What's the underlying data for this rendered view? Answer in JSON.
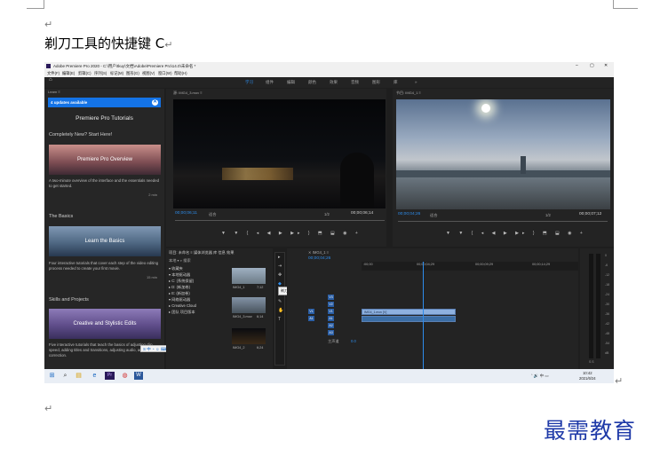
{
  "document": {
    "paragraph_mark": "↵",
    "heading": "剃刀工具的快捷键 C",
    "watermark": "最需教育"
  },
  "app": {
    "title": "Adobe Premiere Pro 2020 - C:\\用户\\tkuy\\文档\\Adobe\\Premiere Pro\\14.0\\未命名 *",
    "window_controls": [
      "–",
      "▢",
      "✕"
    ],
    "menu": [
      "文件(F)",
      "编辑(E)",
      "剪辑(C)",
      "序列(S)",
      "标记(M)",
      "图形(G)",
      "视图(V)",
      "窗口(W)",
      "帮助(H)"
    ],
    "workspaces": [
      "学习",
      "组件",
      "编辑",
      "颜色",
      "效果",
      "音频",
      "图形",
      "库"
    ],
    "active_workspace": "学习",
    "home_icon": "⌂",
    "more_icon": "»"
  },
  "learn": {
    "header": "Learn ≡",
    "updates": "4 updates available",
    "close_icon": "✕",
    "title": "Premiere Pro Tutorials",
    "sections": [
      {
        "heading": "Completely New? Start Here!",
        "card": "Premiere Pro Overview",
        "desc": "A two-minute overview of the interface and the essentials needed to get started.",
        "duration": "2 min"
      },
      {
        "heading": "The Basics",
        "card": "Learn the Basics",
        "desc": "Four interactive tutorials that cover each step of the video editing process needed to create your first movie.",
        "duration": "15 min"
      },
      {
        "heading": "Skills and Projects",
        "card": "Creative and Stylistic Edits",
        "desc": "Five interactive tutorials that teach the basics of adjusting clip speed, adding titles and transitions, adjusting audio, and color correction.",
        "duration": ""
      }
    ]
  },
  "source_monitor": {
    "tab": "源: IMG4_3.mov ≡",
    "timecode_left": "00;00;06;11",
    "fit": "适合",
    "ratio": "1/2",
    "timecode_right": "00;00;06;14",
    "controls": "▼ ▼ { ◂ ◀ ▶ ▶▸ } ⬒ ⬓ ◉ +"
  },
  "program_monitor": {
    "tab": "节目: IMG4_1 ≡",
    "timecode_left": "00;00;04;26",
    "fit": "适合",
    "ratio": "1/2",
    "timecode_right": "00;00;07;12",
    "controls": "▼ ▼ { ◂ ◀ ▶ ▶▸ } ⬒ ⬓ ◉ +"
  },
  "project": {
    "tabs": "项目: 未命名 ≡   媒体浏览器   库   信息   效果",
    "location": "本地 ▾   ⌕ 搜索",
    "tree": [
      "▾ 收藏夹",
      "▾ 本地驱动器",
      "  ▸ C: (系统保留)",
      "  ▸ D: (新加卷)",
      "  ▸ E: (新加卷)",
      "▾ 网络驱动器",
      "▸ Creative Cloud",
      "  ▸ 团队 项目版本"
    ],
    "clips": [
      {
        "name": "IMG4_1",
        "dur": "7;12"
      },
      {
        "name": "IMG4_3.mov",
        "dur": "6;14"
      },
      {
        "name": "IMG4_2",
        "dur": "6;24"
      }
    ]
  },
  "toolbar": {
    "tools": [
      "▸",
      "⇥",
      "✥",
      "◆",
      "⟷",
      "✎",
      "✋",
      "T"
    ],
    "tooltip": "剃刀工具 (C)"
  },
  "timeline": {
    "tab": "✕ IMG4_1 ≡",
    "timecode": "00;00;04;26",
    "ruler": [
      ":00;00",
      "00;00;04;29",
      "00;00;09;29",
      "00;00;14;29"
    ],
    "tracks": [
      "V3",
      "V2",
      "V1",
      "A1",
      "A2",
      "A3"
    ],
    "master": "主声道",
    "master_val": "0.0",
    "video_clip": "IMG4_1.mov [V]",
    "audio_clip": ""
  },
  "meters": {
    "ticks": [
      "0",
      "-6",
      "-12",
      "-18",
      "-24",
      "-30",
      "-36",
      "-42",
      "-48",
      "-54",
      "dB"
    ],
    "solo": "S S"
  },
  "taskbar": {
    "icons": [
      "⊞",
      "⌕",
      "▤",
      "e",
      "Pr",
      "◍",
      "W"
    ],
    "tray": "ˆ 🔊 中 ▭",
    "time": "10:42",
    "date": "2021/6/24"
  },
  "ime_toolbar": "S 中 ◔ ☺ ⌨ ✉ ◐ ⚙"
}
